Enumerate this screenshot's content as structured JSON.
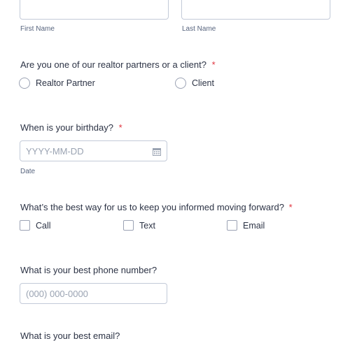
{
  "name_field": {
    "first_sublabel": "First Name",
    "last_sublabel": "Last Name"
  },
  "partner_question": {
    "label": "Are you one of our realtor partners or a client?",
    "required_mark": "*",
    "options": [
      "Realtor Partner",
      "Client"
    ]
  },
  "birthday_question": {
    "label": "When is your birthday?",
    "required_mark": "*",
    "placeholder": "YYYY-MM-DD",
    "sublabel": "Date",
    "icon": "calendar-icon"
  },
  "contact_question": {
    "label": "What’s the best way for us to keep you informed moving forward?",
    "required_mark": "*",
    "options": [
      "Call",
      "Text",
      "Email"
    ]
  },
  "phone_question": {
    "label": "What is your best phone number?",
    "placeholder": "(000) 000-0000"
  },
  "email_question": {
    "label": "What is your best email?"
  },
  "colors": {
    "text": "#2c3345",
    "required": "#e0343e",
    "border": "#c3cad8",
    "placeholder": "#9aa3b2"
  }
}
